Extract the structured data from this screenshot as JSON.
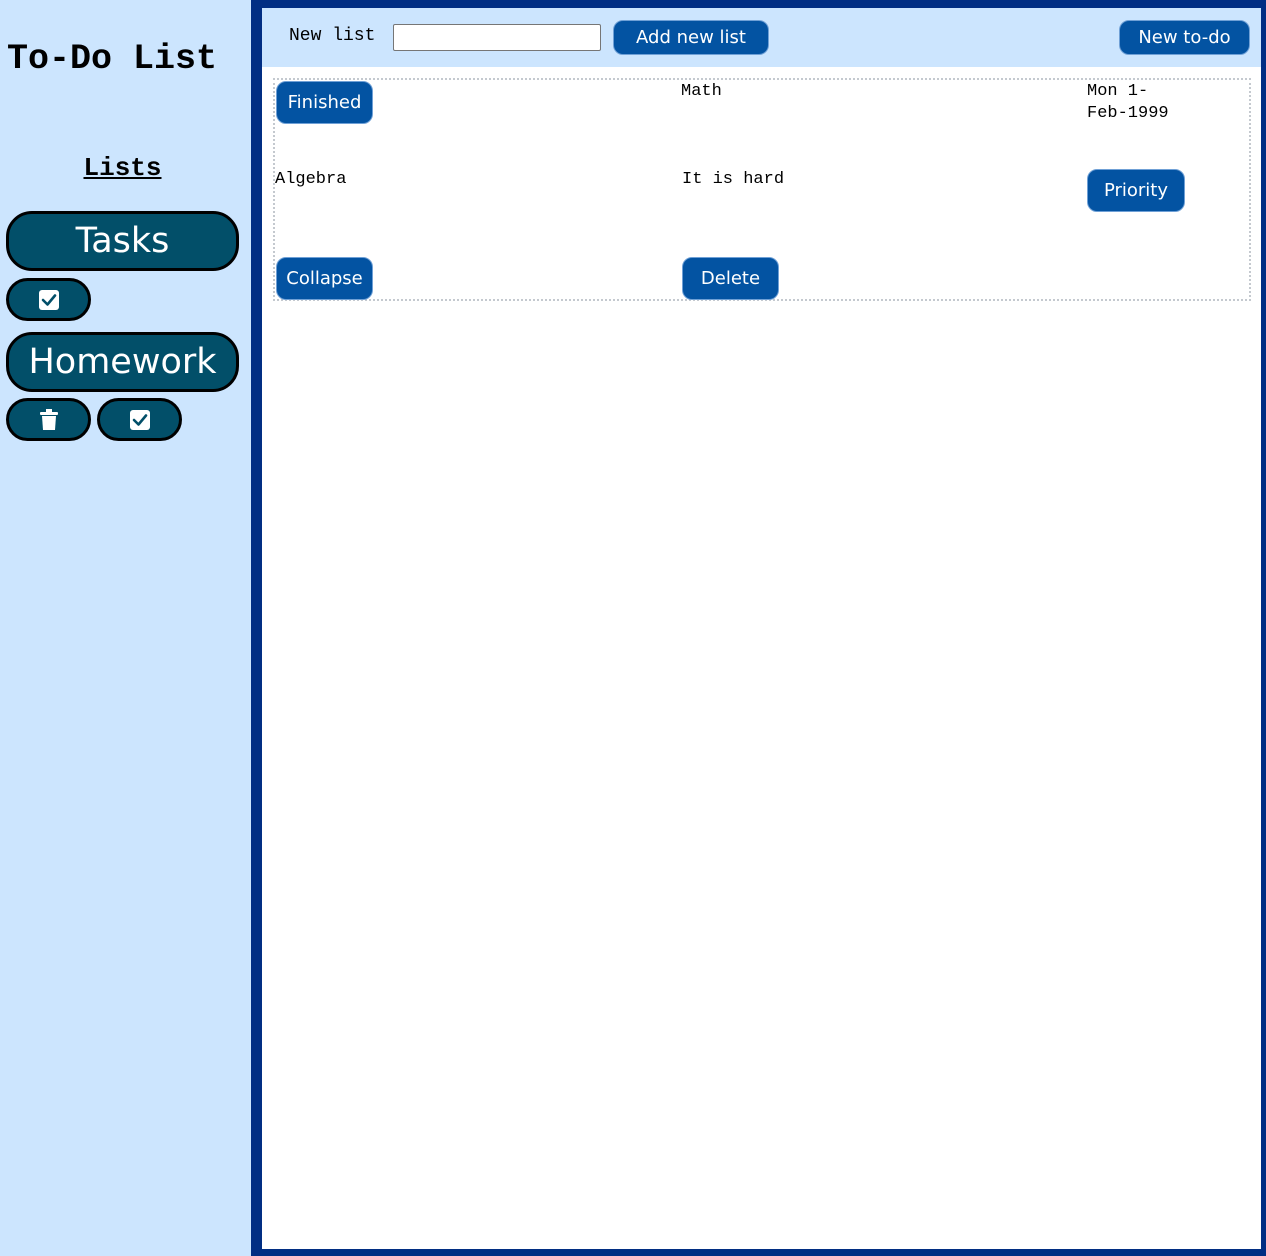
{
  "sidebar": {
    "app_title": "To-Do List",
    "lists_heading": "Lists",
    "lists": [
      {
        "name": "Tasks",
        "actions": [
          "check-icon"
        ]
      },
      {
        "name": "Homework",
        "actions": [
          "trash-icon",
          "check-icon"
        ]
      }
    ]
  },
  "toolbar": {
    "new_list_label": "New list",
    "new_list_value": "",
    "add_list_label": "Add new list",
    "new_todo_label": "New to-do"
  },
  "todo": {
    "finished_label": "Finished",
    "list_name": "Math",
    "due_date": "Mon 1-Feb-1999",
    "title": "Algebra",
    "description": "It is hard",
    "priority_label": "Priority",
    "collapse_label": "Collapse",
    "delete_label": "Delete"
  },
  "colors": {
    "sidebar_bg": "#cce5fe",
    "list_button_bg": "#024f69",
    "action_button_bg": "#0353a2",
    "frame_border": "#012e83"
  }
}
